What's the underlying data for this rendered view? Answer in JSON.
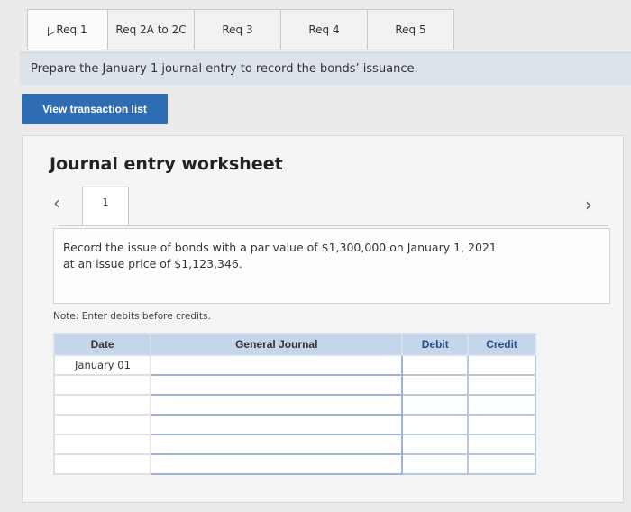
{
  "tabs": [
    {
      "label": "Req 1",
      "active": true
    },
    {
      "label": "Req 2A to 2C",
      "active": false
    },
    {
      "label": "Req 3",
      "active": false
    },
    {
      "label": "Req 4",
      "active": false
    },
    {
      "label": "Req 5",
      "active": false
    }
  ],
  "instruction": "Prepare the January 1 journal entry to record the bonds’ issuance.",
  "view_button": "View transaction list",
  "worksheet": {
    "title": "Journal entry worksheet",
    "entry_number": "1",
    "description_line1": "Record the issue of bonds with a par value of $1,300,000 on January 1, 2021",
    "description_line2": "at an issue price of $1,123,346.",
    "note": "Note: Enter debits before credits."
  },
  "table": {
    "headers": {
      "date": "Date",
      "journal": "General Journal",
      "debit": "Debit",
      "credit": "Credit"
    },
    "rows": [
      {
        "date": "January 01"
      },
      {
        "date": ""
      },
      {
        "date": ""
      },
      {
        "date": ""
      },
      {
        "date": ""
      },
      {
        "date": ""
      }
    ]
  },
  "colors": {
    "accent": "#2e6db4",
    "header_bg": "#c6d6ea",
    "instruction_bg": "#dde3eb"
  }
}
